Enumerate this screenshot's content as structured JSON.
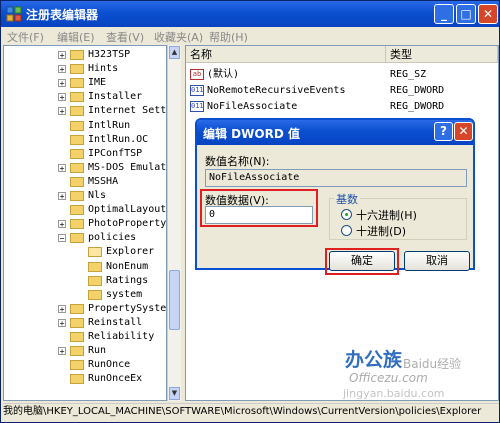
{
  "window": {
    "title": "注册表编辑器",
    "min": "_",
    "max": "□",
    "close": "✕"
  },
  "menu": [
    "文件(F)",
    "编辑(E)",
    "查看(V)",
    "收藏夹(A)",
    "帮助(H)"
  ],
  "tree": [
    {
      "label": "H323TSP",
      "exp": "+"
    },
    {
      "label": "Hints",
      "exp": "+"
    },
    {
      "label": "IME",
      "exp": "+"
    },
    {
      "label": "Installer",
      "exp": "+"
    },
    {
      "label": "Internet Setti",
      "exp": "+"
    },
    {
      "label": "IntlRun",
      "exp": ""
    },
    {
      "label": "IntlRun.OC",
      "exp": ""
    },
    {
      "label": "IPConfTSP",
      "exp": ""
    },
    {
      "label": "MS-DOS Emulati",
      "exp": "+"
    },
    {
      "label": "MSSHA",
      "exp": ""
    },
    {
      "label": "Nls",
      "exp": "+"
    },
    {
      "label": "OptimalLayout",
      "exp": ""
    },
    {
      "label": "PhotoPropertyH",
      "exp": "+"
    },
    {
      "label": "policies",
      "exp": "−"
    },
    {
      "label": "Explorer",
      "exp": "",
      "child": true,
      "open": true
    },
    {
      "label": "NonEnum",
      "exp": "",
      "child": true
    },
    {
      "label": "Ratings",
      "exp": "",
      "child": true
    },
    {
      "label": "system",
      "exp": "",
      "child": true
    },
    {
      "label": "PropertySystem",
      "exp": "+"
    },
    {
      "label": "Reinstall",
      "exp": "+"
    },
    {
      "label": "Reliability",
      "exp": ""
    },
    {
      "label": "Run",
      "exp": "+"
    },
    {
      "label": "RunOnce",
      "exp": ""
    },
    {
      "label": "RunOnceEx",
      "exp": ""
    }
  ],
  "list": {
    "col_name": "名称",
    "col_type": "类型",
    "rows": [
      {
        "icon": "ab",
        "name": "(默认)",
        "type": "REG_SZ"
      },
      {
        "icon": "011",
        "name": "NoRemoteRecursiveEvents",
        "type": "REG_DWORD"
      },
      {
        "icon": "011",
        "name": "NoFileAssociate",
        "type": "REG_DWORD"
      }
    ]
  },
  "dialog": {
    "title": "编辑 DWORD 值",
    "help": "?",
    "close": "✕",
    "name_label": "数值名称(N):",
    "name_value": "NoFileAssociate",
    "data_label": "数值数据(V):",
    "data_value": "0",
    "base_label": "基数",
    "hex_label": "十六进制(H)",
    "dec_label": "十进制(D)",
    "ok": "确定",
    "cancel": "取消"
  },
  "status": "我的电脑\\HKEY_LOCAL_MACHINE\\SOFTWARE\\Microsoft\\Windows\\CurrentVersion\\policies\\Explorer",
  "watermark": {
    "brand": "办公族",
    "site": "Officezu.com",
    "line2": "Baidu经验",
    "line3": "jingyan.baidu.com"
  }
}
